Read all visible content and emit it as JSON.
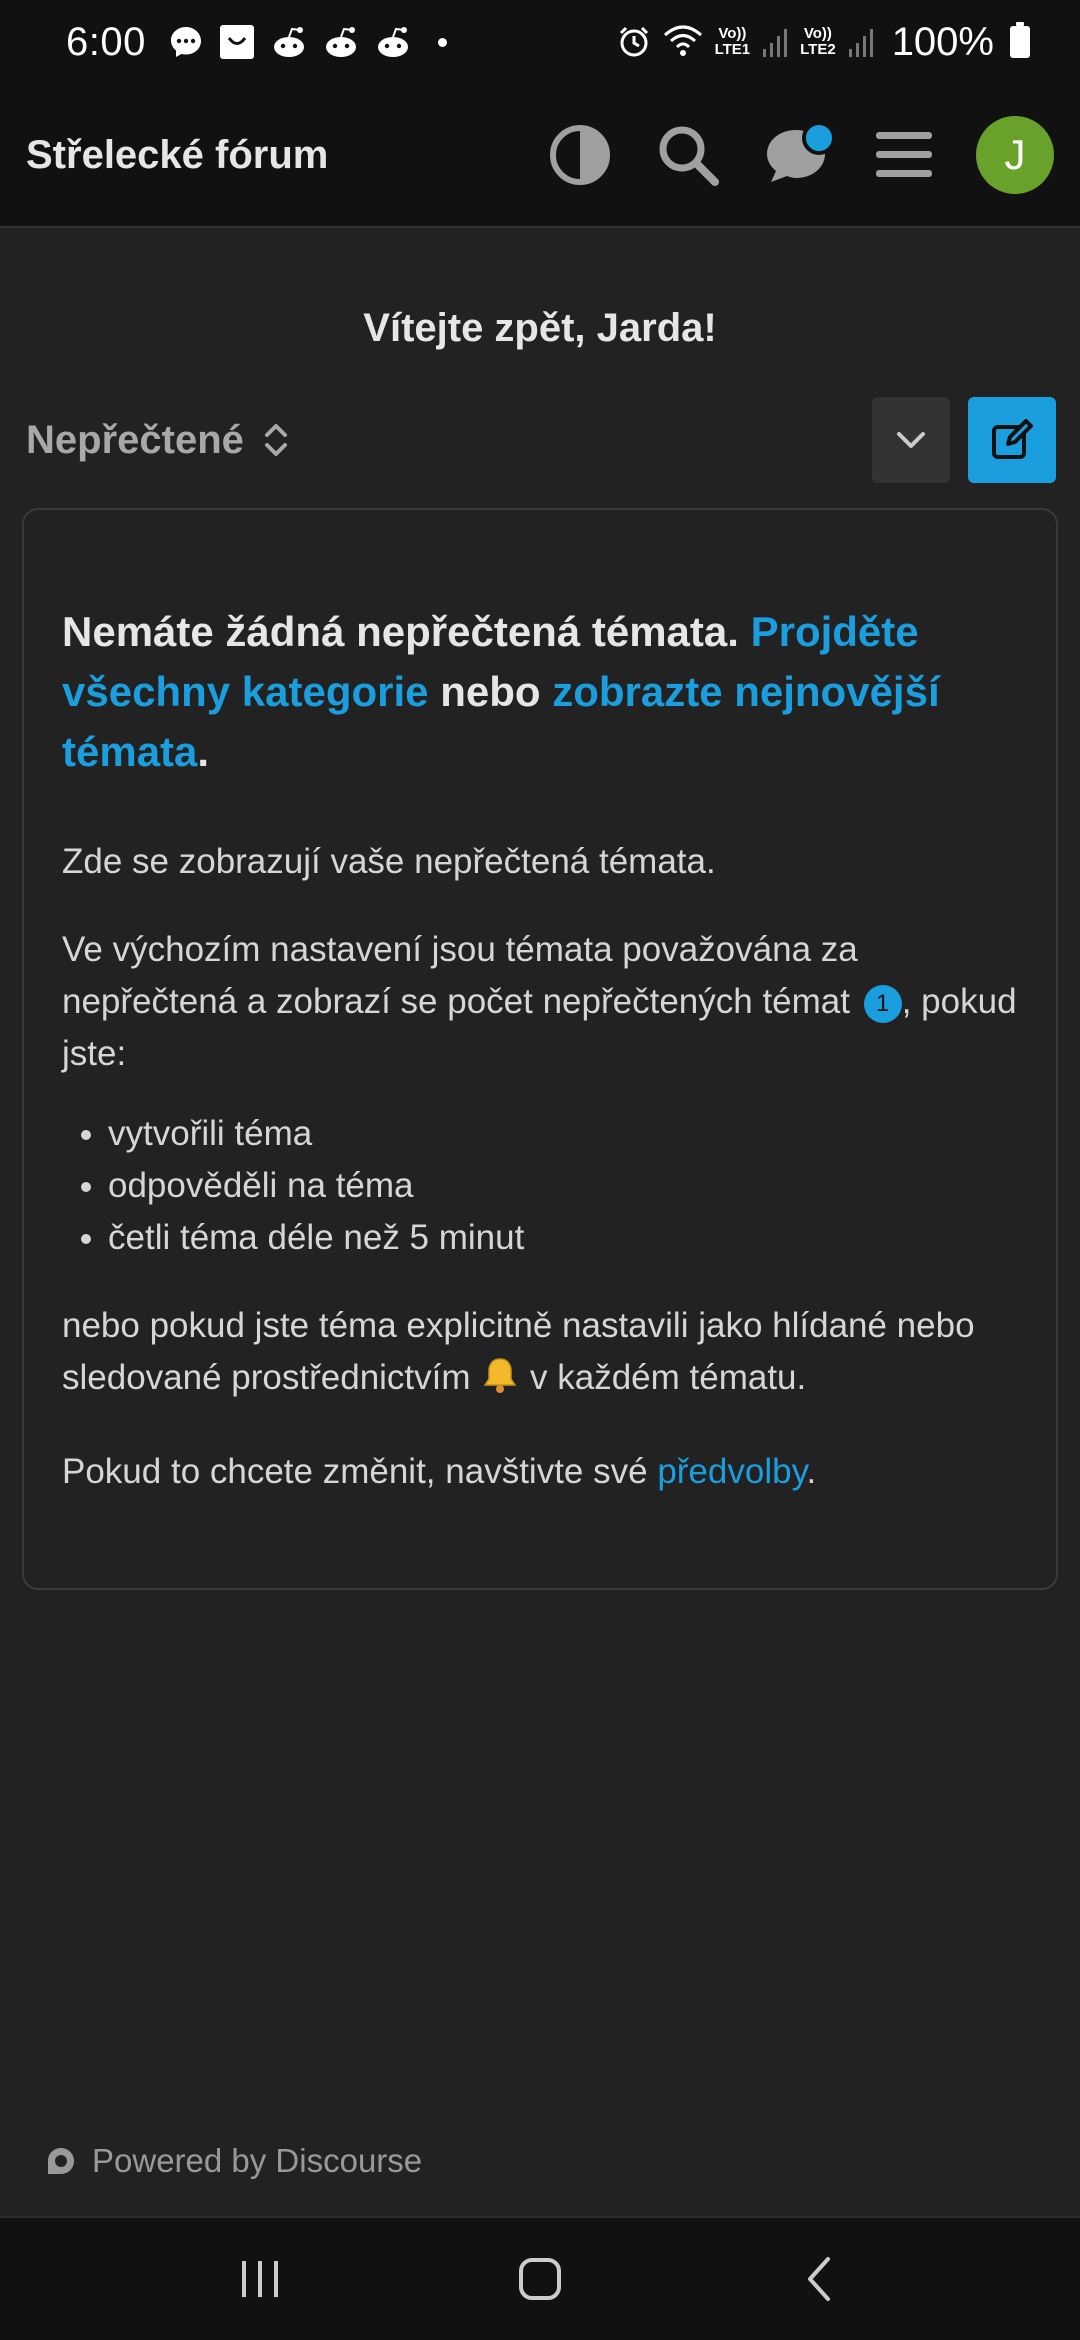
{
  "status_bar": {
    "time": "6:00",
    "net1": "LTE1",
    "net2": "LTE2",
    "volte": "Vo))",
    "battery": "100%",
    "notification_icons": [
      "messenger-icon",
      "shopping-bag-icon",
      "reddit-icon",
      "reddit-icon",
      "reddit-icon"
    ]
  },
  "header": {
    "title": "Střelecké fórum",
    "avatar_letter": "J"
  },
  "welcome": "Vítejte zpět, Jarda!",
  "filter": {
    "label": "Nepřečtené"
  },
  "empty_state": {
    "title_text": "Nemáte žádná nepřečtená témata.",
    "title_link1": "Projděte všechny kategorie",
    "title_mid": "nebo",
    "title_link2": "zobrazte nejnovější témata",
    "title_end": ".",
    "para1": "Zde se zobrazují vaše nepřečtená témata.",
    "para2_a": "Ve výchozím nastavení jsou témata považována za nepřečtená a zobrazí se počet nepřečtených témat",
    "badge": "1",
    "para2_b": ", pokud jste:",
    "list": [
      "vytvořili téma",
      "odpověděli na téma",
      "četli téma déle než 5 minut"
    ],
    "para3_a": "nebo pokud jste téma explicitně nastavili jako hlídané nebo sledované prostřednictvím",
    "para3_b": "v každém tématu.",
    "para4_a": "Pokud to chcete změnit, navštivte své",
    "para4_link": "předvolby",
    "para4_end": "."
  },
  "footer": "Powered by Discourse",
  "colors": {
    "accent": "#1a9ede",
    "avatar": "#69a22b",
    "background": "#222222",
    "header": "#111111"
  }
}
